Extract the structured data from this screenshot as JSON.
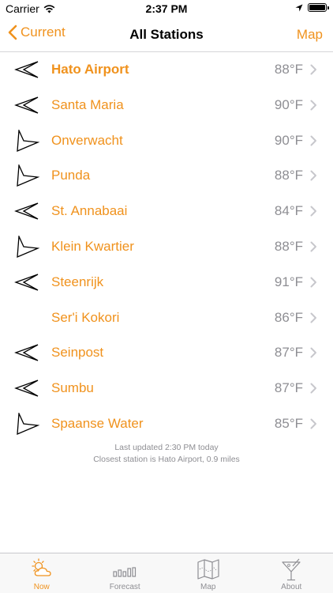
{
  "status_bar": {
    "carrier": "Carrier",
    "time": "2:37 PM"
  },
  "nav": {
    "back_label": "Current",
    "title": "All Stations",
    "map_label": "Map"
  },
  "stations": [
    {
      "name": "Hato Airport",
      "temp": "88°F",
      "wind": "left",
      "bold": true
    },
    {
      "name": "Santa Maria",
      "temp": "90°F",
      "wind": "left",
      "bold": false
    },
    {
      "name": "Onverwacht",
      "temp": "90°F",
      "wind": "up",
      "bold": false
    },
    {
      "name": "Punda",
      "temp": "88°F",
      "wind": "up",
      "bold": false
    },
    {
      "name": "St. Annabaai",
      "temp": "84°F",
      "wind": "left",
      "bold": false
    },
    {
      "name": "Klein Kwartier",
      "temp": "88°F",
      "wind": "up",
      "bold": false
    },
    {
      "name": "Steenrijk",
      "temp": "91°F",
      "wind": "left",
      "bold": false
    },
    {
      "name": "Ser'i Kokori",
      "temp": "86°F",
      "wind": "none",
      "bold": false
    },
    {
      "name": "Seinpost",
      "temp": "87°F",
      "wind": "left",
      "bold": false
    },
    {
      "name": "Sumbu",
      "temp": "87°F",
      "wind": "left",
      "bold": false
    },
    {
      "name": "Spaanse Water",
      "temp": "85°F",
      "wind": "up",
      "bold": false
    }
  ],
  "footer": {
    "last_updated": "Last updated 2:30 PM today",
    "closest": "Closest station is Hato Airport, 0.9 miles"
  },
  "tabs": [
    {
      "label": "Now",
      "icon": "sun-cloud-icon",
      "active": true
    },
    {
      "label": "Forecast",
      "icon": "bars-icon",
      "active": false
    },
    {
      "label": "Map",
      "icon": "map-icon",
      "active": false
    },
    {
      "label": "About",
      "icon": "cocktail-icon",
      "active": false
    }
  ],
  "colors": {
    "accent": "#f0921d",
    "secondary_text": "#8e8e93"
  }
}
